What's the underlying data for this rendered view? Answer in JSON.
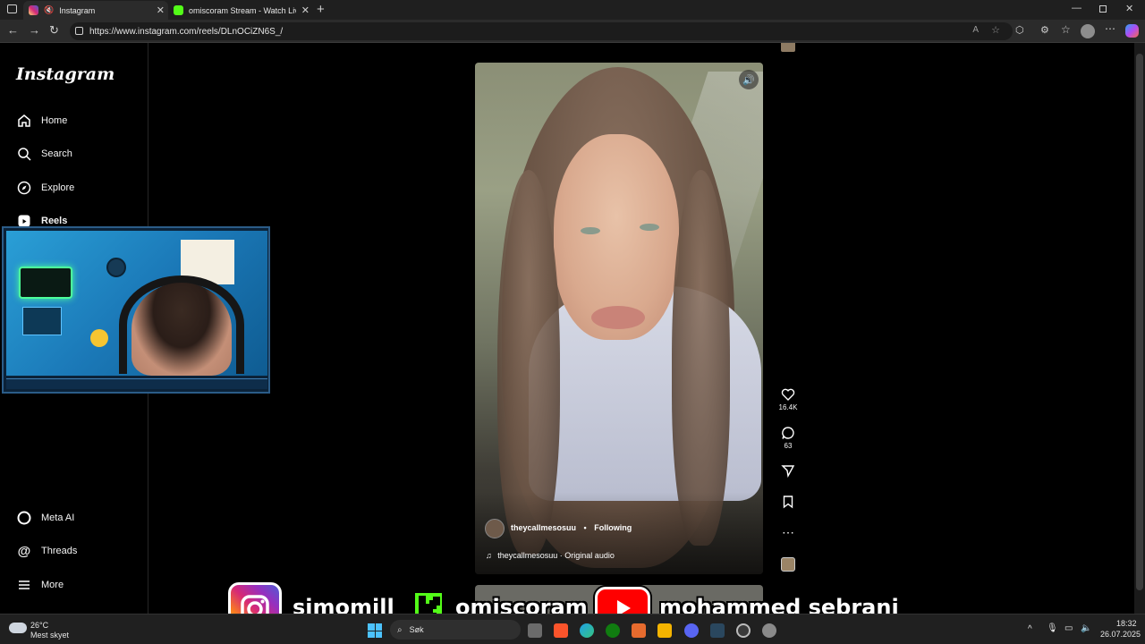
{
  "browser": {
    "tabs": [
      {
        "title": "Instagram",
        "active": true
      },
      {
        "title": "omiscoram Stream - Watch Live o",
        "active": false
      }
    ],
    "url": "https://www.instagram.com/reels/DLnOCiZN6S_/"
  },
  "instagram": {
    "logo": "Instagram",
    "nav_top": [
      {
        "label": "Home",
        "icon": "home-icon"
      },
      {
        "label": "Search",
        "icon": "search-icon"
      },
      {
        "label": "Explore",
        "icon": "compass-icon"
      },
      {
        "label": "Reels",
        "icon": "reels-icon"
      }
    ],
    "nav_bottom": [
      {
        "label": "Meta AI",
        "icon": "meta-ai-icon"
      },
      {
        "label": "Threads",
        "icon": "threads-icon"
      },
      {
        "label": "More",
        "icon": "menu-icon"
      }
    ],
    "reel": {
      "username": "theycallmesosuu",
      "follow_status": "Following",
      "audio": "theycallmesosuu · Original audio",
      "likes": "16.4K",
      "comments": "63"
    }
  },
  "overlay": {
    "instagram_handle": "simomill",
    "kick_handle": "omiscoram",
    "youtube_handle": "mohammed sebrani"
  },
  "taskbar": {
    "weather_temp": "26°C",
    "weather_desc": "Mest skyet",
    "search_placeholder": "Søk",
    "time": "18:32",
    "date": "26.07.2025"
  },
  "colors": {
    "instagram_gradient": [
      "#feda75",
      "#fa7e1e",
      "#d62976",
      "#962fbf",
      "#4f5bd5"
    ],
    "kick_green": "#53fc18",
    "youtube_red": "#ff0000",
    "page_bg": "#000000"
  }
}
